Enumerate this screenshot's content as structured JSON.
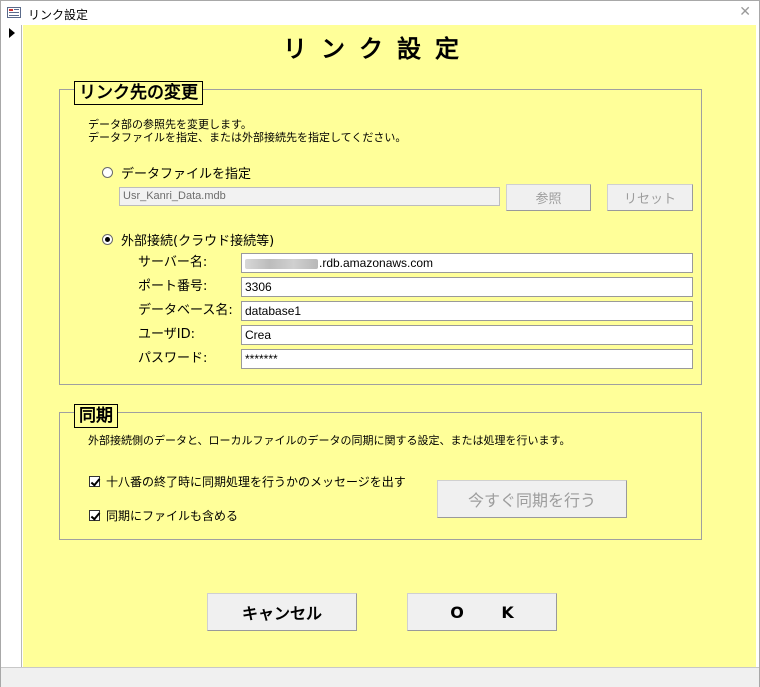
{
  "window": {
    "title": "リンク設定",
    "close_glyph": "✕"
  },
  "form": {
    "title": "リンク設定"
  },
  "link_group": {
    "legend": "リンク先の変更",
    "desc_line1": "データ部の参照先を変更します。",
    "desc_line2": "データファイルを指定、または外部接続先を指定してください。",
    "data_file_option": {
      "label": "データファイルを指定",
      "selected": false,
      "path_value": "Usr_Kanri_Data.mdb",
      "browse_label": "参照",
      "reset_label": "リセット"
    },
    "external_option": {
      "label": "外部接続(クラウド接続等)",
      "selected": true
    },
    "fields": {
      "server_label": "サーバー名:",
      "server_value": ".rdb.amazonaws.com",
      "port_label": "ポート番号:",
      "port_value": "3306",
      "database_label": "データベース名:",
      "database_value": "database1",
      "user_label": "ユーザID:",
      "user_value": "Crea",
      "password_label": "パスワード:",
      "password_value": "*******"
    }
  },
  "sync_group": {
    "legend": "同期",
    "desc": "外部接続側のデータと、ローカルファイルのデータの同期に関する設定、または処理を行います。",
    "option1": {
      "label": "十八番の終了時に同期処理を行うかのメッセージを出す",
      "checked": true
    },
    "option2": {
      "label": "同期にファイルも含める",
      "checked": true
    },
    "sync_now_label": "今すぐ同期を行う"
  },
  "actions": {
    "cancel_label": "キャンセル",
    "ok_label": "O K"
  }
}
